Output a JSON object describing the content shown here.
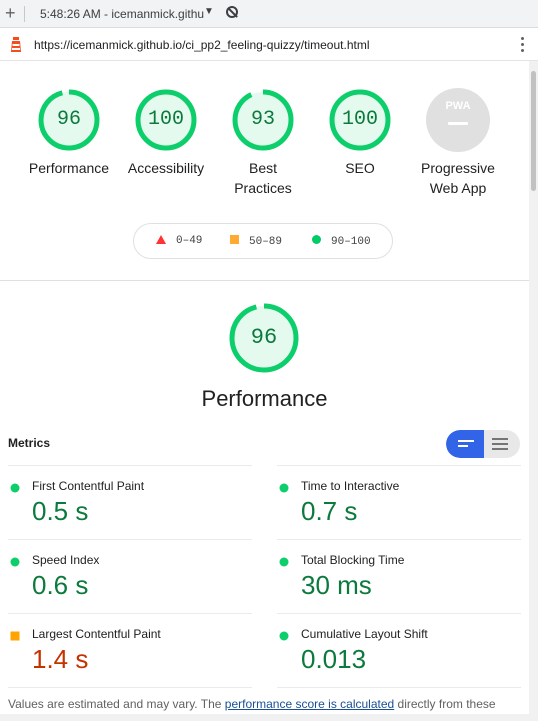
{
  "browser": {
    "tab_title": "5:48:26 AM - icemanmick.githu",
    "url": "https://icemanmick.github.io/ci_pp2_feeling-quizzy/timeout.html"
  },
  "categories": [
    {
      "label": "Performance",
      "score": "96",
      "level": 0.96
    },
    {
      "label": "Accessibility",
      "score": "100",
      "level": 1.0
    },
    {
      "label": "Best\nPractices",
      "score": "93",
      "level": 0.93
    },
    {
      "label": "SEO",
      "score": "100",
      "level": 1.0
    },
    {
      "label": "Progressive\nWeb App",
      "score": "PWA"
    }
  ],
  "legend": {
    "fail": "0–49",
    "average": "50–89",
    "pass": "90–100"
  },
  "performance": {
    "score": "96",
    "level": 0.96,
    "title": "Performance",
    "metrics_heading": "Metrics"
  },
  "metrics": [
    {
      "name": "First Contentful Paint",
      "value": "0.5 s",
      "rating": "pass"
    },
    {
      "name": "Time to Interactive",
      "value": "0.7 s",
      "rating": "pass"
    },
    {
      "name": "Speed Index",
      "value": "0.6 s",
      "rating": "pass"
    },
    {
      "name": "Total Blocking Time",
      "value": "30 ms",
      "rating": "pass"
    },
    {
      "name": "Largest Contentful Paint",
      "value": "1.4 s",
      "rating": "average"
    },
    {
      "name": "Cumulative Layout Shift",
      "value": "0.013",
      "rating": "pass"
    }
  ],
  "footer": {
    "prefix": "Values are estimated and may vary. The ",
    "link": "performance score is calculated",
    "suffix": " directly from these"
  },
  "colors": {
    "pass": "#0cce6b",
    "pass_text": "#0c7a3c",
    "average": "#ffa400",
    "average_text": "#c33300",
    "fail": "#ff3333",
    "accent": "#3164e7"
  }
}
